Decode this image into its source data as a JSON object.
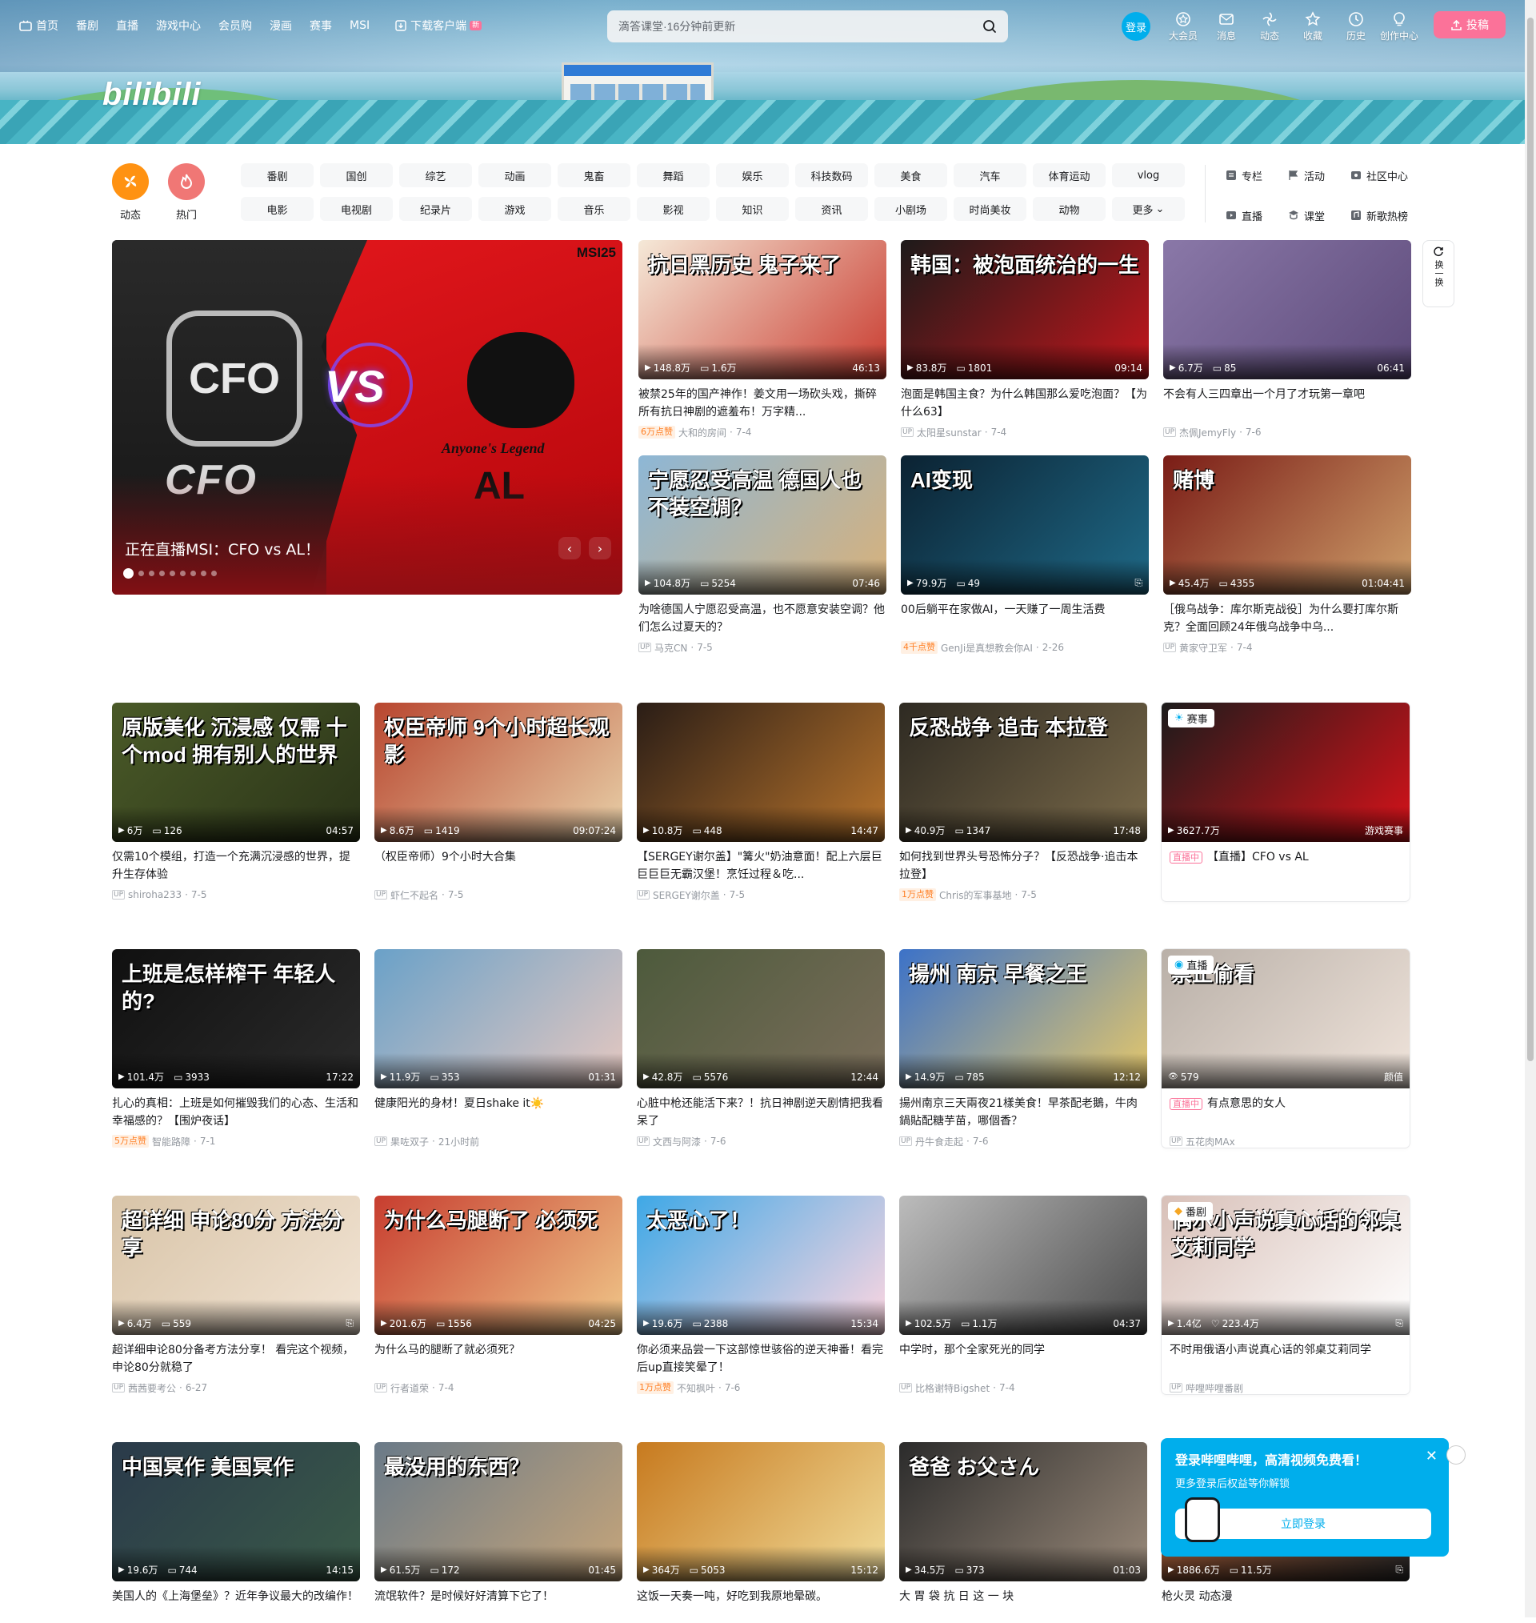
{
  "topnav": {
    "items": [
      {
        "label": "首页",
        "icon": "tv-icon"
      },
      {
        "label": "番剧"
      },
      {
        "label": "直播"
      },
      {
        "label": "游戏中心"
      },
      {
        "label": "会员购"
      },
      {
        "label": "漫画"
      },
      {
        "label": "赛事"
      },
      {
        "label": "MSI"
      },
      {
        "label": "下载客户端",
        "icon": "download-icon",
        "badge": "新"
      }
    ]
  },
  "search": {
    "placeholder": "滴答课堂·16分钟前更新"
  },
  "userbar": {
    "login": "登录",
    "items": [
      {
        "label": "大会员",
        "icon": "vip-icon"
      },
      {
        "label": "消息",
        "icon": "message-icon"
      },
      {
        "label": "动态",
        "icon": "dynamic-icon"
      },
      {
        "label": "收藏",
        "icon": "star-icon"
      },
      {
        "label": "历史",
        "icon": "clock-icon"
      },
      {
        "label": "创作中心",
        "icon": "bulb-icon"
      }
    ],
    "upload": "投稿"
  },
  "banner": {
    "logo": "bilibili"
  },
  "channels": {
    "dynamic": "动态",
    "hot": "热门",
    "tags": [
      "番剧",
      "国创",
      "综艺",
      "动画",
      "鬼畜",
      "舞蹈",
      "娱乐",
      "科技数码",
      "美食",
      "汽车",
      "体育运动",
      "vlog",
      "电影",
      "电视剧",
      "纪录片",
      "游戏",
      "音乐",
      "影视",
      "知识",
      "资讯",
      "小剧场",
      "时尚美妆",
      "动物",
      "更多"
    ],
    "side": [
      {
        "label": "专栏",
        "icon": "column-icon"
      },
      {
        "label": "活动",
        "icon": "flag-icon"
      },
      {
        "label": "社区中心",
        "icon": "community-icon"
      },
      {
        "label": "直播",
        "icon": "live-icon"
      },
      {
        "label": "课堂",
        "icon": "classroom-icon"
      },
      {
        "label": "新歌热榜",
        "icon": "music-icon"
      }
    ]
  },
  "carousel": {
    "title": "正在直播MSI：CFO vs AL！",
    "badge": "MSI25",
    "left_team": "CFO",
    "vs": "VS",
    "right_team": "AL",
    "right_team_sub": "Anyone's Legend",
    "dots": 9
  },
  "refresh": {
    "label": "换一换"
  },
  "cards": [
    {
      "title": "被禁25年的国产神作！姜文用一场砍头戏，撕碎所有抗日神剧的遮羞布！万字精...",
      "views": "148.8万",
      "danmaku": "1.6万",
      "duration": "46:13",
      "likes": "6万点赞",
      "author": "大和的房间",
      "date": "7-4",
      "thumb_text": "抗日黑历史 鬼子来了"
    },
    {
      "title": "泡面是韩国主食？为什么韩国那么爱吃泡面？【为什么63】",
      "views": "83.8万",
      "danmaku": "1801",
      "duration": "09:14",
      "author": "太阳星sunstar",
      "date": "7-4",
      "thumb_text": "韩国：被泡面统治的一生"
    },
    {
      "title": "不会有人三四章出一个月了才玩第一章吧",
      "views": "6.7万",
      "danmaku": "85",
      "duration": "06:41",
      "author": "杰佩JemyFly",
      "date": "7-6"
    },
    {
      "title": "为啥德国人宁愿忍受高温，也不愿意安装空调？他们怎么过夏天的？",
      "views": "104.8万",
      "danmaku": "5254",
      "duration": "07:46",
      "author": "马克CN",
      "date": "7-5",
      "thumb_text": "宁愿忍受高温 德国人也不装空调？"
    },
    {
      "title": "00后躺平在家做AI，一天赚了一周生活费",
      "views": "79.9万",
      "danmaku": "49",
      "duration": "",
      "likes": "4千点赞",
      "author": "GenJi是真想教会你AI",
      "date": "2-26",
      "thumb_text": "AI变现"
    },
    {
      "title": "［俄乌战争：库尔斯克战役］为什么要打库尔斯克？全面回顾24年俄乌战争中乌...",
      "views": "45.4万",
      "danmaku": "4355",
      "duration": "01:04:41",
      "author": "黄家守卫军",
      "date": "7-4",
      "thumb_text": "赌博"
    },
    {
      "title": "仅需10个模组，打造一个充满沉浸感的世界，提升生存体验",
      "views": "6万",
      "danmaku": "126",
      "duration": "04:57",
      "author": "shiroha233",
      "date": "7-5",
      "thumb_text": "原版美化 沉浸感 仅需 十个mod 拥有别人的世界"
    },
    {
      "title": "（权臣帝师）9个小时大合集",
      "views": "8.6万",
      "danmaku": "1419",
      "duration": "09:07:24",
      "author": "虾仁不起名",
      "date": "7-5",
      "thumb_text": "权臣帝师 9个小时超长观影"
    },
    {
      "title": "【SERGEY谢尔盖】\"篝火\"奶油意面！配上六层巨巨巨巨无霸汉堡！烹饪过程＆吃...",
      "views": "10.8万",
      "danmaku": "448",
      "duration": "14:47",
      "author": "SERGEY谢尔盖",
      "date": "7-5"
    },
    {
      "title": "如何找到世界头号恐怖分子？【反恐战争·追击本拉登】",
      "views": "40.9万",
      "danmaku": "1347",
      "duration": "17:48",
      "likes": "1万点赞",
      "author": "Chris的军事基地",
      "date": "7-5",
      "thumb_text": "反恐战争 追击 本拉登"
    },
    {
      "title": "【直播】CFO vs AL",
      "views": "3627.7万",
      "corner": "赛事",
      "live": "直播中",
      "category": "游戏赛事"
    },
    {
      "title": "扎心的真相：上班是如何摧毁我们的心态、生活和幸福感的？【围炉夜话】",
      "views": "101.4万",
      "danmaku": "3933",
      "duration": "17:22",
      "likes": "5万点赞",
      "author": "智能路障",
      "date": "7-1",
      "thumb_text": "上班是怎样榨干 年轻人的?"
    },
    {
      "title": "健康阳光的身材！夏日shake it☀️",
      "views": "11.9万",
      "danmaku": "353",
      "duration": "01:31",
      "author": "果咗双子",
      "date": "21小时前"
    },
    {
      "title": "心脏中枪还能活下来？！抗日神剧逆天剧情把我看呆了",
      "views": "42.8万",
      "danmaku": "5576",
      "duration": "12:44",
      "author": "文西与阿漆",
      "date": "7-6"
    },
    {
      "title": "揚州南京三天兩夜21樣美食！早茶配老鵝，牛肉鍋貼配糖芋苗，哪個香？",
      "views": "14.9万",
      "danmaku": "785",
      "duration": "12:12",
      "author": "丹牛食走起",
      "date": "7-6",
      "thumb_text": "揚州 南京 早餐之王"
    },
    {
      "title": "有点意思的女人",
      "views": "579",
      "corner": "直播",
      "live": "直播中",
      "category": "颜值",
      "author": "五花肉MAx",
      "thumb_text": "禁止偷看"
    },
    {
      "title": "超详细申论80分备考方法分享！ 看完这个视频，申论80分就稳了",
      "views": "6.4万",
      "danmaku": "559",
      "duration": "",
      "author": "茜茜要考公",
      "date": "6-27",
      "thumb_text": "超详细 申论80分 方法分享"
    },
    {
      "title": "为什么马的腿断了就必须死？",
      "views": "201.6万",
      "danmaku": "1556",
      "duration": "04:25",
      "author": "行者道荣",
      "date": "7-4",
      "thumb_text": "为什么马腿断了 必须死"
    },
    {
      "title": "你必须来品尝一下这部惊世骇俗的逆天神番！看完后up直接笑晕了！",
      "views": "19.6万",
      "danmaku": "2388",
      "duration": "15:34",
      "likes": "1万点赞",
      "author": "不知枫叶",
      "date": "7-6",
      "thumb_text": "太恶心了！"
    },
    {
      "title": "中学时，那个全家死光的同学",
      "views": "102.5万",
      "danmaku": "1.1万",
      "duration": "04:37",
      "author": "比格谢特Bigshet",
      "date": "7-4"
    },
    {
      "title": "不时用俄语小声说真心话的邻桌艾莉同学",
      "views": "1.4亿",
      "danmaku": "223.4万",
      "corner": "番剧",
      "author": "哔哩哔哩番剧",
      "thumb_text": "偶尔小声说真心话的邻桌艾莉同学"
    },
    {
      "title": "美国人的《上海堡垒》？近年争议最大的改编作！",
      "views": "19.6万",
      "danmaku": "744",
      "duration": "14:15",
      "thumb_text": "中国冥作 美国冥作"
    },
    {
      "title": "流氓软件？是时候好好清算下它了！",
      "views": "61.5万",
      "danmaku": "172",
      "duration": "01:45",
      "thumb_text": "最没用的东西？"
    },
    {
      "title": "这饭一天奏一吨，好吃到我原地晕碳。",
      "views": "364万",
      "danmaku": "5053",
      "duration": "15:12"
    },
    {
      "title": "大 胃 袋 抗 日 这 一 块",
      "views": "34.5万",
      "danmaku": "373",
      "duration": "01:03",
      "thumb_text": "爸爸 お父さん"
    },
    {
      "title": "枪火灵 动态漫",
      "views": "1886.6万",
      "danmaku": "11.5万"
    }
  ],
  "popup": {
    "title": "登录哔哩哔哩，高清视频免费看！",
    "subtitle": "更多登录后权益等你解锁",
    "button": "立即登录"
  }
}
